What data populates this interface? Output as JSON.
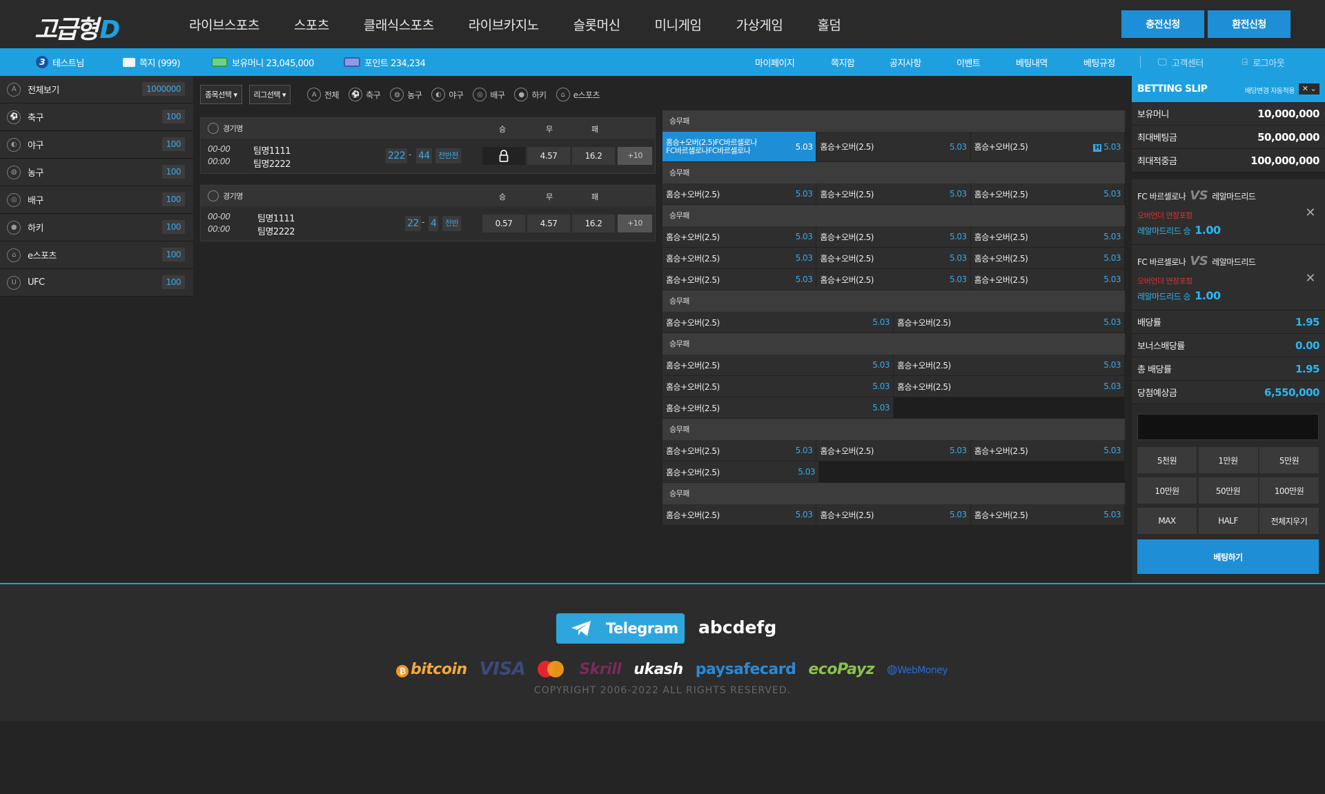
{
  "header": {
    "logo": "고급형",
    "logo_mark": "D",
    "nav": [
      "라이브스포츠",
      "스포츠",
      "클래식스포츠",
      "라이브카지노",
      "슬롯머신",
      "미니게임",
      "가상게임",
      "홀덤"
    ],
    "deposit_button": "충전신청",
    "withdraw_button": "환전신청"
  },
  "userbar": {
    "level": "3",
    "username": "테스트님",
    "messages": "쪽지 (999)",
    "money": "보유머니 23,045,000",
    "points": "포인트 234,234",
    "menu": [
      "마이페이지",
      "쪽지함",
      "공지사항",
      "이벤트",
      "베팅내역",
      "베팅규정"
    ],
    "support": "고객센터",
    "logout": "로그아웃"
  },
  "sidebar": {
    "items": [
      {
        "label": "전체보기",
        "count": "1000000",
        "icon": "A"
      },
      {
        "label": "축구",
        "count": "100",
        "icon": "⚽"
      },
      {
        "label": "야구",
        "count": "100",
        "icon": "◐"
      },
      {
        "label": "농구",
        "count": "100",
        "icon": "◍"
      },
      {
        "label": "배구",
        "count": "100",
        "icon": "◎"
      },
      {
        "label": "하키",
        "count": "100",
        "icon": "●"
      },
      {
        "label": "e스포츠",
        "count": "100",
        "icon": "⌂"
      },
      {
        "label": "UFC",
        "count": "100",
        "icon": "U"
      }
    ]
  },
  "filters": {
    "sport_select": "종목선택 ▾",
    "league_select": "리그선택 ▾",
    "tabs": [
      {
        "label": "전체",
        "icon": "A"
      },
      {
        "label": "축구",
        "icon": "⚽"
      },
      {
        "label": "농구",
        "icon": "◍"
      },
      {
        "label": "야구",
        "icon": "◐"
      },
      {
        "label": "배구",
        "icon": "◎"
      },
      {
        "label": "하키",
        "icon": "●"
      },
      {
        "label": "e스포츠",
        "icon": "⌂"
      }
    ]
  },
  "games": [
    {
      "title": "경기명",
      "col_win": "승",
      "col_draw": "무",
      "col_lose": "패",
      "time1": "00-00",
      "time2": "00:00",
      "team1": "팀명1111",
      "team2": "팀명2222",
      "score1": "222",
      "sep": "-",
      "score2": "44",
      "phase": "전반전",
      "win": "",
      "draw": "4.57",
      "lose": "16.2",
      "more": "+10"
    },
    {
      "title": "경기명",
      "col_win": "승",
      "col_draw": "무",
      "col_lose": "패",
      "time1": "00-00",
      "time2": "00:00",
      "team1": "팀명1111",
      "team2": "팀명2222",
      "score1": "22",
      "sep": "-",
      "score2": "4",
      "phase": "전반",
      "win": "0.57",
      "draw": "4.57",
      "lose": "16.2",
      "more": "+10"
    }
  ],
  "markets": {
    "header": "승무패",
    "label": "홈승+오버(2.5)",
    "active_label": "홈승+오버(2.5)FC바르셀로나FC바르셀로나FC바르셀로나",
    "odd": "5.03",
    "h_badge": "H"
  },
  "slip": {
    "title": "BETTING SLIP",
    "auto_apply": "배당변경 자동적용",
    "close_toggle": "✕ ⌄",
    "balance_label": "보유머니",
    "balance": "10,000,000",
    "max_bet_label": "최대베팅금",
    "max_bet": "50,000,000",
    "max_win_label": "최대적중금",
    "max_win": "100,000,000",
    "picks": [
      {
        "home": "FC 바르셀로나",
        "away": "레알마드리드",
        "vs": "VS",
        "market": "오버언더 연장포함",
        "selection": "레알마드리드 승",
        "odd": "1.00"
      },
      {
        "home": "FC 바르셀로나",
        "away": "레알마드리드",
        "vs": "VS",
        "market": "오버언더 연장포함",
        "selection": "레알마드리드 승",
        "odd": "1.00"
      }
    ],
    "odds_label": "배당률",
    "odds": "1.95",
    "bonus_label": "보너스배당률",
    "bonus": "0.00",
    "total_label": "총 배당률",
    "total": "1.95",
    "expected_label": "당첨예상금",
    "expected": "6,550,000",
    "chips": [
      "5천원",
      "1만원",
      "5만원",
      "10만원",
      "50만원",
      "100만원",
      "MAX",
      "HALF",
      "전체지우기"
    ],
    "bet_button": "베팅하기"
  },
  "footer": {
    "telegram": "Telegram",
    "telegram_id": "abcdefg",
    "payments": [
      "bitcoin",
      "VISA",
      "Skrill",
      "ukash",
      "paysafecard",
      "ecoPayz",
      "WebMoney"
    ],
    "copyright": "COPYRIGHT  2006-2022  ALL RIGHTS RESERVED."
  },
  "colors": {
    "accent": "#1ea0e0",
    "odds": "#3aa8e8",
    "alert": "#e03232"
  }
}
